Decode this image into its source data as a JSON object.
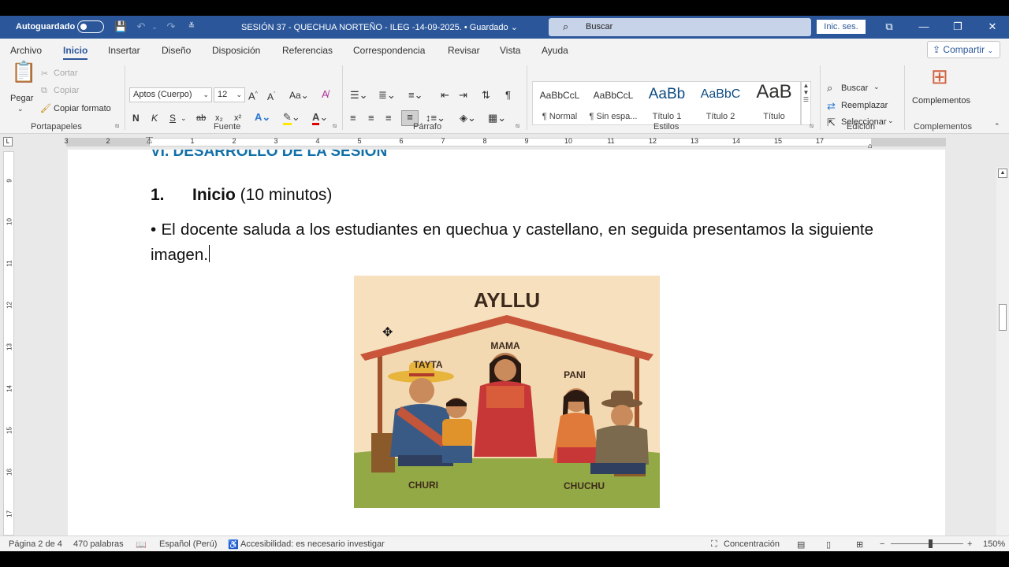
{
  "titlebar": {
    "autosave_label": "Autoguardado",
    "doc_title": "SESIÓN 37 - QUECHUA NORTEÑO - ILEG -14-09-2025. • Guardado ⌄",
    "search_placeholder": "Buscar",
    "signin_label": "Inic. ses.",
    "accent_color": "#2b579a"
  },
  "menu": {
    "tabs": [
      "Archivo",
      "Inicio",
      "Insertar",
      "Diseño",
      "Disposición",
      "Referencias",
      "Correspondencia",
      "Revisar",
      "Vista",
      "Ayuda"
    ],
    "active_tab": "Inicio",
    "share_label": "Compartir"
  },
  "ribbon": {
    "clipboard": {
      "paste": "Pegar",
      "cut": "Cortar",
      "copy": "Copiar",
      "format_painter": "Copiar formato",
      "group": "Portapapeles"
    },
    "font": {
      "family": "Aptos (Cuerpo)",
      "size": "12",
      "group": "Fuente",
      "bold": "N",
      "italic": "K",
      "underline": "S",
      "strike": "ab",
      "subscript": "x₂",
      "superscript": "x²"
    },
    "paragraph": {
      "group": "Párrafo"
    },
    "styles": {
      "group": "Estilos",
      "items": [
        {
          "preview": "AaBbCcL",
          "name": "¶ Normal"
        },
        {
          "preview": "AaBbCcL",
          "name": "¶ Sin espa..."
        },
        {
          "preview": "AaBb",
          "name": "Título 1"
        },
        {
          "preview": "AaBbC",
          "name": "Título 2"
        },
        {
          "preview": "AaB",
          "name": "Título"
        }
      ]
    },
    "editing": {
      "group": "Edición",
      "find": "Buscar",
      "replace": "Reemplazar",
      "select": "Seleccionar"
    },
    "addins": {
      "label": "Complementos",
      "group": "Complementos"
    }
  },
  "ruler": {
    "numbers": [
      "3",
      "2",
      "1",
      "1",
      "2",
      "3",
      "4",
      "5",
      "6",
      "7",
      "8",
      "9",
      "10",
      "11",
      "12",
      "13",
      "14",
      "15",
      "17"
    ],
    "vertical_numbers": [
      "9",
      "10",
      "11",
      "12",
      "13",
      "14",
      "15",
      "16",
      "17"
    ]
  },
  "document": {
    "heading": "VI. DESARROLLO DE LA SESIÓN",
    "item_number": "1.",
    "item_title": "Inicio",
    "item_rest": " (10 minutos)",
    "paragraph": "• El docente saluda a los estudiantes en quechua y castellano, en seguida presentamos la siguiente imagen.",
    "image": {
      "title": "AYLLU",
      "labels": [
        "MAMA",
        "TAYTA",
        "PANI",
        "CHURI",
        "CHUCHU"
      ]
    }
  },
  "statusbar": {
    "page": "Página 2 de 4",
    "words": "470 palabras",
    "language": "Español (Perú)",
    "accessibility": "Accesibilidad: es necesario investigar",
    "focus": "Concentración",
    "zoom": "150%"
  }
}
